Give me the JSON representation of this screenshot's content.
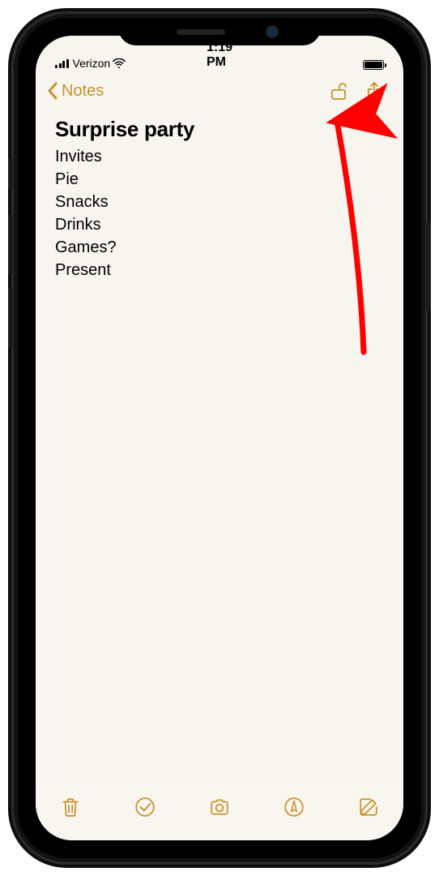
{
  "status": {
    "carrier": "Verizon",
    "time": "1:19 PM"
  },
  "nav": {
    "back_label": "Notes"
  },
  "note": {
    "title": "Surprise party",
    "lines": [
      "Invites",
      "Pie",
      "Snacks",
      "Drinks",
      "Games?",
      "Present"
    ]
  },
  "colors": {
    "accent": "#c7922b",
    "annotation": "#ff0000"
  }
}
